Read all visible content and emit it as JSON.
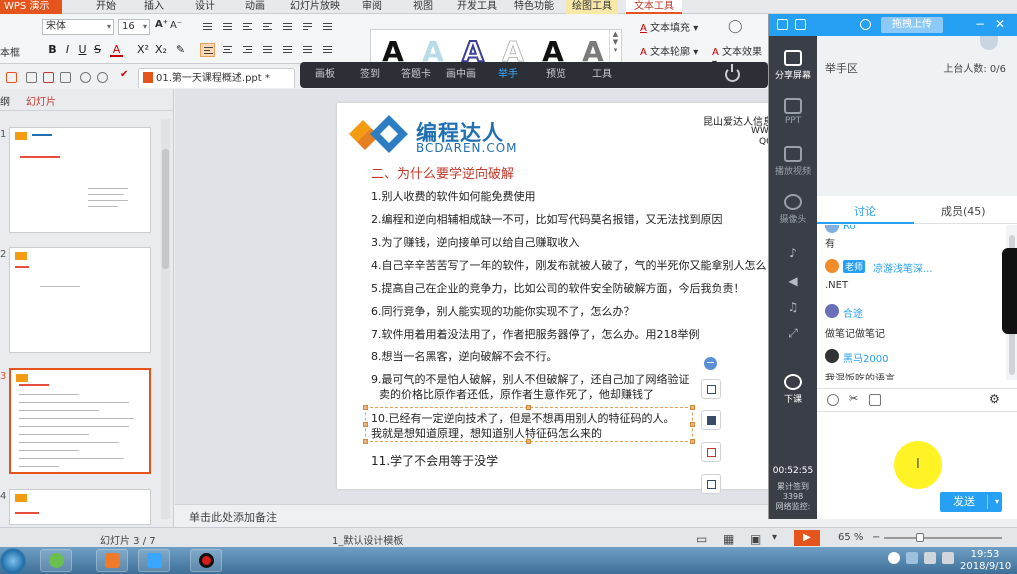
{
  "app_name": "WPS 演示",
  "ribbon": {
    "tabs": [
      "开始",
      "插入",
      "设计",
      "动画",
      "幻灯片放映",
      "审阅",
      "视图",
      "开发工具",
      "特色功能",
      "绘图工具",
      "文本工具"
    ],
    "active_tab": "文本工具"
  },
  "toolbar": {
    "font_name": "宋体",
    "font_size": "16",
    "textbox_label": "本框",
    "format_buttons": [
      "B",
      "I",
      "U",
      "S",
      "A",
      "X²",
      "X₂",
      "✎"
    ],
    "text_fill_label": "文本填充",
    "text_outline_label": "文本轮廓",
    "text_effects_label": "文本效果"
  },
  "doc_tab": {
    "title": "01.第一天课程概述.ppt *"
  },
  "show_toolbar": {
    "items": [
      "画板",
      "签到",
      "答题卡",
      "画中画",
      "举手",
      "预览",
      "工具"
    ],
    "active": "举手"
  },
  "left_pane": {
    "tabs": [
      "纲",
      "幻灯片"
    ],
    "active_tab": "幻灯片",
    "slide_numbers": [
      "1",
      "2",
      "3",
      "4"
    ],
    "selected_slide": "3"
  },
  "slide": {
    "logo_text": "编程达人",
    "logo_sub": "BCDAREN.COM",
    "company": "昆山爱达人信息",
    "company_line2": "WW",
    "company_line3": "QQ",
    "title": "二、为什么要学逆向破解",
    "points": [
      "1.别人收费的软件如何能免费使用",
      "2.编程和逆向相辅相成缺一不可，比如写代码莫名报错，又无法找到原因",
      "3.为了赚钱，逆向接单可以给自己赚取收入",
      "4.自己辛辛苦苦写了一年的软件，刚发布就被人破了，气的半死你又能拿别人怎么",
      "5.提高自己在企业的竞争力，比如公司的软件安全防破解方面，今后我负责！",
      "6.同行竞争，别人能实现的功能你实现不了，怎么办？",
      "7.软件用着用着没法用了，作者把服务器停了，怎么办。用218举例",
      "8.想当一名黑客，逆向破解不会不行。",
      "9.最可气的不是怕人破解，别人不但破解了，还自己加了网络验证",
      "卖的价格比原作者还低，原作者生意作死了，他却赚钱了",
      "10.已经有一定逆向技术了，但是不想再用别人的特征码的人。",
      "我就是想知道原理，想知道别人特征码怎么来的",
      "11.学了不会用等于没学"
    ]
  },
  "notes": {
    "placeholder": "单击此处添加备注"
  },
  "status_bar": {
    "slide_count": "幻灯片 3 / 7",
    "template": "1_默认设计模板",
    "zoom": "65 %"
  },
  "taskbar": {
    "time": "19:53",
    "date": "2018/9/10"
  },
  "live_panel": {
    "upload_label": "拖拽上传",
    "side_items": [
      "分享屏幕",
      "PPT",
      "播放视频",
      "摄像头"
    ],
    "end_class_label": "下课",
    "timer": "00:52:55",
    "stats": [
      "累计签到",
      "3398",
      "网络监控:"
    ],
    "hand_raise_title": "举手区",
    "on_stage_count": "上台人数: 0/6",
    "tabs": [
      "讨论",
      "成员(45)"
    ],
    "active_tab": "讨论",
    "messages": [
      {
        "user": "Ro",
        "text": "有"
      },
      {
        "badge": "老师",
        "user": "凉游浅笔深...",
        "text": ".NET"
      },
      {
        "user": "合途",
        "text": "做笔记做笔记"
      },
      {
        "user": "黑马2000",
        "text": "我混饭吃的语言"
      }
    ],
    "send_label": "发送"
  },
  "colors": {
    "accent": "#e6541d",
    "live_blue": "#25a0f2",
    "slide_title": "#c0392b"
  }
}
